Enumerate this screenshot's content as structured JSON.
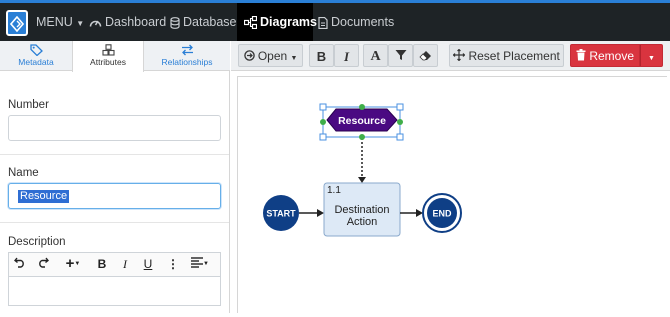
{
  "nav": {
    "menu_label": "MENU",
    "items": [
      {
        "label": "Dashboard"
      },
      {
        "label": "Database"
      },
      {
        "label": "Diagrams"
      },
      {
        "label": "Documents"
      }
    ]
  },
  "side_tabs": [
    {
      "label": "Metadata"
    },
    {
      "label": "Attributes"
    },
    {
      "label": "Relationships"
    }
  ],
  "form": {
    "number_label": "Number",
    "number_value": "",
    "name_label": "Name",
    "name_value": "Resource",
    "description_label": "Description"
  },
  "toolbar": {
    "open_label": "Open",
    "bold_label": "B",
    "italic_label": "I",
    "font_label": "A",
    "reset_label": "Reset Placement",
    "remove_label": "Remove"
  },
  "rte": {
    "bold": "B",
    "italic": "I",
    "underline": "U",
    "more": "⋮"
  },
  "diagram": {
    "resource_label": "Resource",
    "start_label": "START",
    "end_label": "END",
    "action_number": "1.1",
    "action_line1": "Destination",
    "action_line2": "Action"
  },
  "colors": {
    "nav_bg": "#1e2326",
    "accent": "#2a7fd6",
    "danger": "#d9343f",
    "resource_fill": "#4a0a82",
    "event_fill": "#0f3f86"
  }
}
